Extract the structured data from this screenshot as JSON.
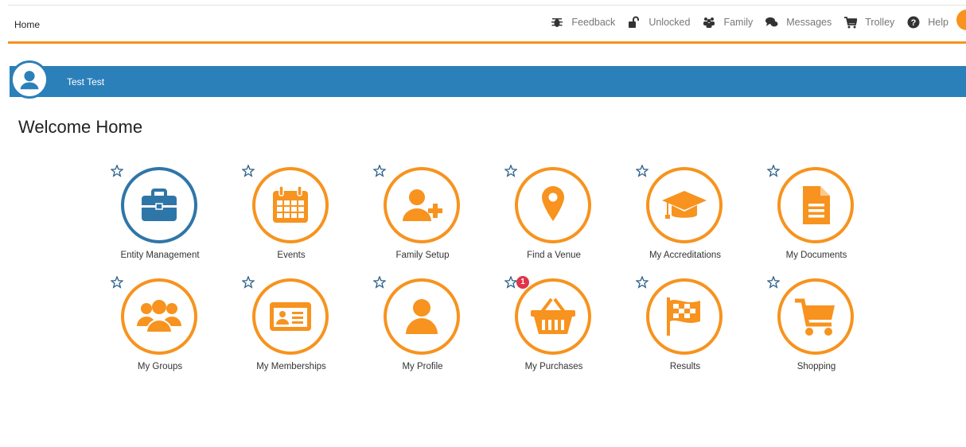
{
  "header": {
    "home_label": "Home",
    "nav": [
      {
        "label": "Feedback",
        "icon": "bug-icon"
      },
      {
        "label": "Unlocked",
        "icon": "unlock-icon"
      },
      {
        "label": "Family",
        "icon": "family-icon"
      },
      {
        "label": "Messages",
        "icon": "chat-icon"
      },
      {
        "label": "Trolley",
        "icon": "cart-icon"
      },
      {
        "label": "Help",
        "icon": "help-icon"
      }
    ]
  },
  "user": {
    "name": "Test Test"
  },
  "page": {
    "title": "Welcome Home"
  },
  "tiles": [
    {
      "label": "Entity Management",
      "icon": "briefcase-icon",
      "color": "#2f76a8"
    },
    {
      "label": "Events",
      "icon": "calendar-icon",
      "color": "#f7931e"
    },
    {
      "label": "Family Setup",
      "icon": "add-user-icon",
      "color": "#f7931e"
    },
    {
      "label": "Find a Venue",
      "icon": "map-pin-icon",
      "color": "#f7931e"
    },
    {
      "label": "My Accreditations",
      "icon": "graduation-cap-icon",
      "color": "#f7931e"
    },
    {
      "label": "My Documents",
      "icon": "document-icon",
      "color": "#f7931e"
    },
    {
      "label": "My Groups",
      "icon": "group-icon",
      "color": "#f7931e"
    },
    {
      "label": "My Memberships",
      "icon": "id-card-icon",
      "color": "#f7931e"
    },
    {
      "label": "My Profile",
      "icon": "user-icon",
      "color": "#f7931e"
    },
    {
      "label": "My Purchases",
      "icon": "basket-icon",
      "color": "#f7931e",
      "badge": "1"
    },
    {
      "label": "Results",
      "icon": "checkered-flag-icon",
      "color": "#f7931e"
    },
    {
      "label": "Shopping",
      "icon": "shopping-cart-icon",
      "color": "#f7931e"
    }
  ],
  "colors": {
    "accent": "#f7931e",
    "brand_blue": "#2c80b9",
    "badge_red": "#e0344a"
  }
}
